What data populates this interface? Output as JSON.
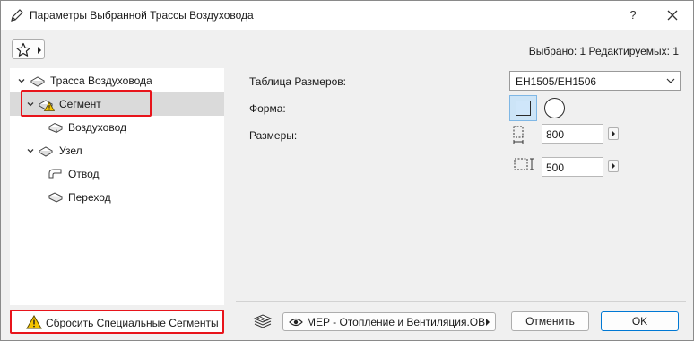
{
  "window": {
    "title": "Параметры Выбранной Трассы Воздуховода",
    "help_label": "?"
  },
  "header": {
    "selected_info": "Выбрано: 1 Редактируемых: 1"
  },
  "tree": {
    "items": [
      {
        "label": "Трасса Воздуховода",
        "expanded": true,
        "selected": false,
        "icon": "duct-route-icon"
      },
      {
        "label": "Сегмент",
        "expanded": true,
        "selected": true,
        "icon": "segment-warning-icon"
      },
      {
        "label": "Воздуховод",
        "selected": false,
        "icon": "duct-icon"
      },
      {
        "label": "Узел",
        "expanded": true,
        "selected": false,
        "icon": "node-icon"
      },
      {
        "label": "Отвод",
        "selected": false,
        "icon": "elbow-icon"
      },
      {
        "label": "Переход",
        "selected": false,
        "icon": "transition-icon"
      }
    ]
  },
  "reset_button": {
    "label": "Сбросить Специальные Сегменты",
    "icon": "warning-icon"
  },
  "form": {
    "size_table_label": "Таблица Размеров:",
    "size_table_value": "EH1505/EH1506",
    "shape_label": "Форма:",
    "shape_selected": "rectangle",
    "dimensions_label": "Размеры:",
    "width_value": "800",
    "height_value": "500"
  },
  "footer": {
    "view_label": "MEP - Отопление и Вентиляция.OB",
    "cancel_label": "Отменить",
    "ok_label": "OK"
  },
  "colors": {
    "highlight_red": "#e8141b",
    "selected_row": "#dadada",
    "shape_selected_bg": "#cce4f7",
    "ok_border": "#0078d4",
    "warning_yellow": "#f5c400"
  }
}
